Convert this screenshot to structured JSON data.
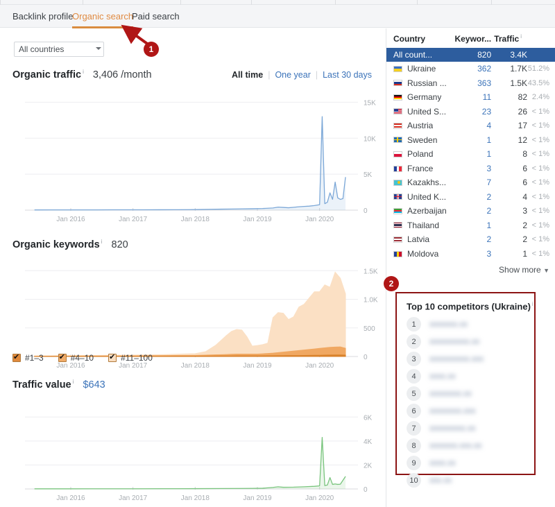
{
  "tabs": [
    {
      "label": "Backlink profile",
      "active": false
    },
    {
      "label": "Organic search",
      "active": true
    },
    {
      "label": "Paid search",
      "active": false
    }
  ],
  "filters": {
    "country_selected": "All countries",
    "country_options": [
      "All countries"
    ]
  },
  "metrics": {
    "organic_traffic": {
      "label": "Organic traffic",
      "value": "3,406 /month"
    },
    "organic_keywords": {
      "label": "Organic keywords",
      "value": "820"
    },
    "traffic_value": {
      "label": "Traffic value",
      "value": "$643"
    }
  },
  "date_ranges": {
    "all_time": "All time",
    "one_year": "One year",
    "last_30": "Last 30 days"
  },
  "keyword_legend": [
    {
      "label": "#1–3",
      "color": "#e08a3c",
      "checked": true
    },
    {
      "label": "#4–10",
      "color": "#f0ab68",
      "checked": true
    },
    {
      "label": "#11–100",
      "color": "#f9ddbf",
      "checked": true
    }
  ],
  "country_table": {
    "headers": [
      "Country",
      "Keywor...",
      "Traffic"
    ],
    "rows": [
      {
        "country": "All count...",
        "keywords": "820",
        "traffic": "3.4K",
        "share": "",
        "flag": "none",
        "selected": true
      },
      {
        "country": "Ukraine",
        "keywords": "362",
        "traffic": "1.7K",
        "share": "51.2%",
        "flag": "ua",
        "selected": false
      },
      {
        "country": "Russian ...",
        "keywords": "363",
        "traffic": "1.5K",
        "share": "43.5%",
        "flag": "ru",
        "selected": false
      },
      {
        "country": "Germany",
        "keywords": "11",
        "traffic": "82",
        "share": "2.4%",
        "flag": "de",
        "selected": false
      },
      {
        "country": "United S...",
        "keywords": "23",
        "traffic": "26",
        "share": "< 1%",
        "flag": "us",
        "selected": false
      },
      {
        "country": "Austria",
        "keywords": "4",
        "traffic": "17",
        "share": "< 1%",
        "flag": "at",
        "selected": false
      },
      {
        "country": "Sweden",
        "keywords": "1",
        "traffic": "12",
        "share": "< 1%",
        "flag": "se",
        "selected": false
      },
      {
        "country": "Poland",
        "keywords": "1",
        "traffic": "8",
        "share": "< 1%",
        "flag": "pl",
        "selected": false
      },
      {
        "country": "France",
        "keywords": "3",
        "traffic": "6",
        "share": "< 1%",
        "flag": "fr",
        "selected": false
      },
      {
        "country": "Kazakhs...",
        "keywords": "7",
        "traffic": "6",
        "share": "< 1%",
        "flag": "kz",
        "selected": false
      },
      {
        "country": "United K...",
        "keywords": "2",
        "traffic": "4",
        "share": "< 1%",
        "flag": "gb",
        "selected": false
      },
      {
        "country": "Azerbaijan",
        "keywords": "2",
        "traffic": "3",
        "share": "< 1%",
        "flag": "az",
        "selected": false
      },
      {
        "country": "Thailand",
        "keywords": "1",
        "traffic": "2",
        "share": "< 1%",
        "flag": "th",
        "selected": false
      },
      {
        "country": "Latvia",
        "keywords": "2",
        "traffic": "2",
        "share": "< 1%",
        "flag": "lv",
        "selected": false
      },
      {
        "country": "Moldova",
        "keywords": "3",
        "traffic": "1",
        "share": "< 1%",
        "flag": "md",
        "selected": false
      }
    ],
    "show_more": "Show more"
  },
  "competitors": {
    "title": "Top 10 competitors (Ukraine)",
    "items": [
      {
        "rank": "1",
        "domain": "xxxxxxx.xx"
      },
      {
        "rank": "2",
        "domain": "xxxxxxxxxx.xx"
      },
      {
        "rank": "3",
        "domain": "xxxxxxxxxx.xxx"
      },
      {
        "rank": "4",
        "domain": "xxxx.xx"
      },
      {
        "rank": "5",
        "domain": "xxxxxxxx.xx"
      },
      {
        "rank": "6",
        "domain": "xxxxxxxx.xxx"
      },
      {
        "rank": "7",
        "domain": "xxxxxxxxx.xx"
      },
      {
        "rank": "8",
        "domain": "xxxxxxx.xxx.xx"
      },
      {
        "rank": "9",
        "domain": "xxxx.xx"
      },
      {
        "rank": "10",
        "domain": "xxx.xx"
      }
    ]
  },
  "annotations": [
    {
      "label": "1"
    },
    {
      "label": "2"
    }
  ],
  "colors": {
    "accent_orange": "#e08b42",
    "link_blue": "#3b73b9",
    "selected_row_blue": "#2d5d9e",
    "annotation_red": "#b01616",
    "traffic_line": "#7ba7d7",
    "value_line": "#78c47c"
  },
  "chart_data": [
    {
      "type": "line",
      "title": "Organic traffic",
      "subtitle": "3,406 /month",
      "ylabel": "",
      "xlabel": "",
      "ylim": [
        0,
        16000
      ],
      "yticks": [
        "15K",
        "10K",
        "5K",
        "0"
      ],
      "ytick_values": [
        15000,
        10000,
        5000,
        0
      ],
      "xticks": [
        "Jan 2016",
        "Jan 2017",
        "Jan 2018",
        "Jan 2019",
        "Jan 2020"
      ],
      "grid": true,
      "legend": "none",
      "series": [
        {
          "name": "Organic traffic",
          "color": "#7ba7d7",
          "x": [
            "2015-06",
            "2015-09",
            "2015-12",
            "2016-03",
            "2016-06",
            "2016-09",
            "2016-12",
            "2017-03",
            "2017-06",
            "2017-09",
            "2017-12",
            "2018-02",
            "2018-04",
            "2018-06",
            "2018-08",
            "2018-10",
            "2018-12",
            "2019-02",
            "2019-04",
            "2019-05",
            "2019-06",
            "2019-07",
            "2019-08",
            "2019-09",
            "2019-10",
            "2019-11",
            "2019-12",
            "2020-01",
            "2020-01b",
            "2020-02",
            "2020-02b",
            "2020-03",
            "2020-03b",
            "2020-04",
            "2020-04b",
            "2020-05",
            "2020-05b",
            "2020-06"
          ],
          "values": [
            30,
            35,
            35,
            40,
            40,
            45,
            45,
            50,
            55,
            60,
            70,
            90,
            120,
            140,
            160,
            180,
            200,
            230,
            300,
            420,
            380,
            330,
            400,
            470,
            520,
            560,
            640,
            760,
            13000,
            900,
            1100,
            2400,
            1500,
            3900,
            1700,
            1500,
            1600,
            4600
          ]
        }
      ]
    },
    {
      "type": "area",
      "title": "Organic keywords",
      "subtitle": "820",
      "ylabel": "",
      "xlabel": "",
      "ylim": [
        0,
        1600
      ],
      "yticks": [
        "1.5K",
        "1.0K",
        "500",
        "0"
      ],
      "ytick_values": [
        1500,
        1000,
        500,
        0
      ],
      "xticks": [
        "Jan 2016",
        "Jan 2017",
        "Jan 2018",
        "Jan 2019",
        "Jan 2020"
      ],
      "grid": true,
      "stacked": true,
      "legend": "bottom",
      "series": [
        {
          "name": "#1–3",
          "color": "#d9822b",
          "x": [
            "2015-06",
            "2016-01",
            "2017-01",
            "2018-01",
            "2018-06",
            "2018-09",
            "2019-01",
            "2019-04",
            "2019-07",
            "2019-10",
            "2020-01",
            "2020-03",
            "2020-05",
            "2020-06"
          ],
          "values": [
            2,
            3,
            4,
            6,
            10,
            12,
            12,
            14,
            16,
            18,
            22,
            26,
            28,
            24
          ]
        },
        {
          "name": "#4–10",
          "color": "#f0a862",
          "x": [
            "2015-06",
            "2016-01",
            "2017-01",
            "2018-01",
            "2018-06",
            "2018-09",
            "2019-01",
            "2019-04",
            "2019-07",
            "2019-10",
            "2020-01",
            "2020-03",
            "2020-05",
            "2020-06"
          ],
          "values": [
            3,
            5,
            8,
            14,
            22,
            30,
            30,
            45,
            70,
            95,
            120,
            135,
            140,
            120
          ]
        },
        {
          "name": "#11–100",
          "color": "#fbe0c4",
          "x": [
            "2015-06",
            "2015-12",
            "2016-06",
            "2017-01",
            "2017-07",
            "2018-01",
            "2018-03",
            "2018-05",
            "2018-07",
            "2018-08",
            "2018-09",
            "2018-10",
            "2018-11",
            "2018-12",
            "2019-01",
            "2019-02",
            "2019-03",
            "2019-04",
            "2019-05",
            "2019-06",
            "2019-07",
            "2019-08",
            "2019-09",
            "2019-10",
            "2019-11",
            "2019-12",
            "2020-01",
            "2020-02",
            "2020-03",
            "2020-04",
            "2020-05",
            "2020-06"
          ],
          "values": [
            5,
            8,
            10,
            14,
            18,
            30,
            60,
            170,
            330,
            400,
            430,
            420,
            300,
            140,
            150,
            160,
            180,
            620,
            700,
            680,
            560,
            600,
            760,
            800,
            900,
            1000,
            990,
            1100,
            1050,
            1310,
            1200,
            950
          ]
        }
      ]
    },
    {
      "type": "line",
      "title": "Traffic value",
      "subtitle": "$643",
      "ylabel": "",
      "xlabel": "",
      "ylim": [
        0,
        7000
      ],
      "yticks": [
        "6K",
        "4K",
        "2K",
        "0"
      ],
      "ytick_values": [
        6000,
        4000,
        2000,
        0
      ],
      "xticks": [
        "Jan 2016",
        "Jan 2017",
        "Jan 2018",
        "Jan 2019",
        "Jan 2020"
      ],
      "grid": true,
      "legend": "none",
      "series": [
        {
          "name": "Traffic value",
          "color": "#78c47c",
          "x": [
            "2015-06",
            "2015-12",
            "2016-06",
            "2017-01",
            "2017-07",
            "2018-01",
            "2018-06",
            "2018-10",
            "2018-12",
            "2019-02",
            "2019-04",
            "2019-05",
            "2019-06",
            "2019-08",
            "2019-10",
            "2019-12",
            "2020-01",
            "2020-01b",
            "2020-02",
            "2020-02b",
            "2020-03",
            "2020-03b",
            "2020-04",
            "2020-04b",
            "2020-05",
            "2020-06"
          ],
          "values": [
            10,
            12,
            14,
            16,
            20,
            25,
            35,
            45,
            50,
            60,
            130,
            180,
            140,
            150,
            180,
            220,
            260,
            4300,
            280,
            330,
            950,
            380,
            420,
            380,
            400,
            1050
          ]
        }
      ]
    }
  ]
}
